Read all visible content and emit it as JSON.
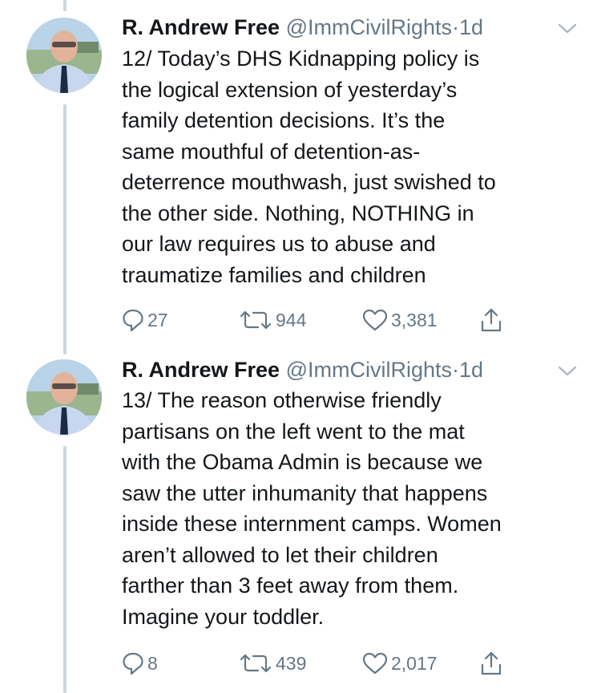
{
  "tweets": [
    {
      "name": "R. Andrew Free",
      "handle": "@ImmCivilRights",
      "separator": "·",
      "time": "1d",
      "lines": [
        "12/ Today’s DHS Kidnapping policy is",
        "the logical extension of yesterday’s",
        "family detention decisions. It’s the",
        "same mouthful of detention-as-",
        "deterrence mouthwash, just swished to",
        "the other side. Nothing, NOTHING in",
        "our law requires us to abuse and",
        "traumatize families and children"
      ],
      "replies": "27",
      "retweets": "944",
      "likes": "3,381"
    },
    {
      "name": "R. Andrew Free",
      "handle": "@ImmCivilRights",
      "separator": "·",
      "time": "1d",
      "lines": [
        "13/ The reason otherwise friendly",
        "partisans on the left went to the mat",
        "with the Obama Admin is because we",
        "saw the utter inhumanity that happens",
        "inside these internment camps. Women",
        "aren’t allowed to let their children",
        "farther than 3 feet away from them.",
        "Imagine your toddler."
      ],
      "replies": "8",
      "retweets": "439",
      "likes": "2,017"
    }
  ],
  "icons": {
    "reply": "reply-icon",
    "retweet": "retweet-icon",
    "like": "heart-icon",
    "share": "share-icon",
    "menu": "chevron-down-icon"
  },
  "colors": {
    "text": "#14171a",
    "secondary": "#657786",
    "thread_line": "#cdd6dd"
  }
}
